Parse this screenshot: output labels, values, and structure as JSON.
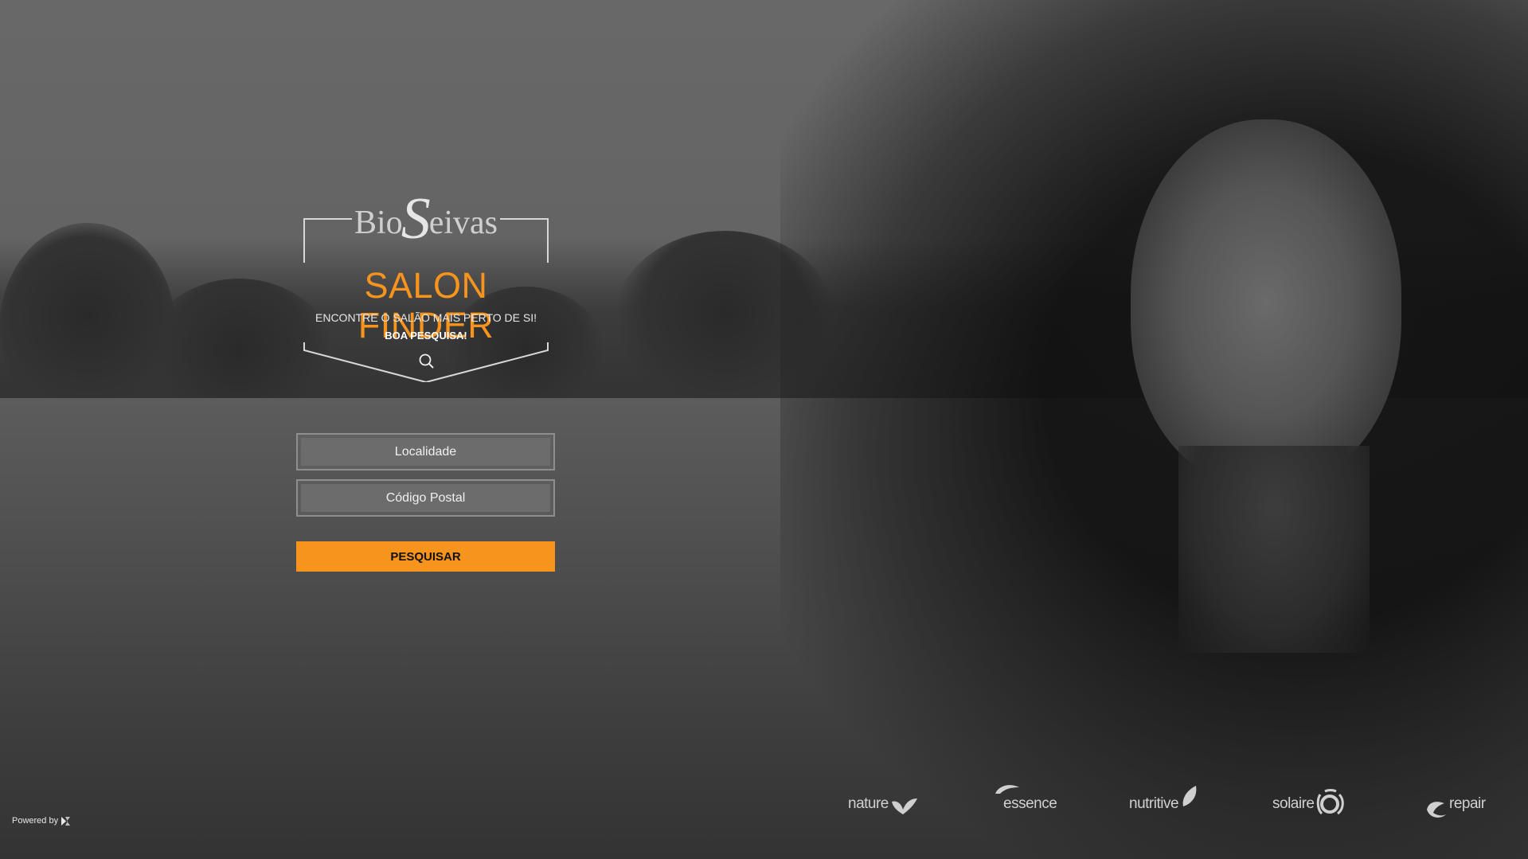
{
  "brand": {
    "logo_left": "Bio",
    "logo_s": "S",
    "logo_right": "eivas"
  },
  "hero": {
    "title": "SALON FINDER",
    "tagline": "ENCONTRE O SALÃO MAIS PERTO DE SI!",
    "tagline_bold": "BOA PESQUISA!"
  },
  "form": {
    "locality_placeholder": "Localidade",
    "postal_placeholder": "Código Postal",
    "search_label": "PESQUISAR"
  },
  "footer": {
    "powered_by": "Powered by"
  },
  "products": [
    {
      "label": "nature",
      "icon": "leaf-bird-icon"
    },
    {
      "label": "essence",
      "icon": "leaf-cap-icon"
    },
    {
      "label": "nutritive",
      "icon": "leaf-drop-icon"
    },
    {
      "label": "solaire",
      "icon": "sun-icon"
    },
    {
      "label": "repair",
      "icon": "leaf-curl-icon"
    }
  ],
  "colors": {
    "accent": "#f7941d",
    "background": "#5f5f5f"
  }
}
